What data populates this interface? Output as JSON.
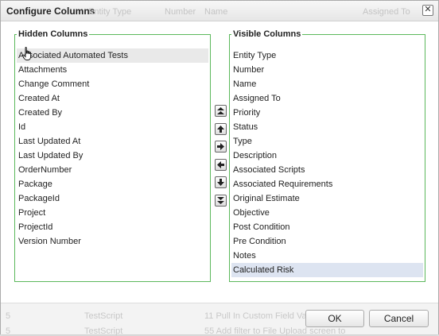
{
  "dialog": {
    "title": "Configure Columns",
    "close_label": "✕",
    "background_headers": [
      "Entity Type",
      "Number",
      "Name",
      "Assigned To"
    ]
  },
  "hidden_columns": {
    "legend": "Hidden Columns",
    "items": [
      "Associated Automated Tests",
      "Attachments",
      "Change Comment",
      "Created At",
      "Created By",
      "Id",
      "Last Updated At",
      "Last Updated By",
      "OrderNumber",
      "Package",
      "PackageId",
      "Project",
      "ProjectId",
      "Version Number"
    ]
  },
  "visible_columns": {
    "legend": "Visible Columns",
    "items": [
      "Entity Type",
      "Number",
      "Name",
      "Assigned To",
      "Priority",
      "Status",
      "Type",
      "Description",
      "Associated Scripts",
      "Associated Requirements",
      "Original Estimate",
      "Objective",
      "Post Condition",
      "Pre Condition",
      "Notes",
      "Calculated Risk"
    ],
    "selected": "Calculated Risk"
  },
  "move_buttons": [
    {
      "name": "move-top-button",
      "icon": "double-up-arrow-icon"
    },
    {
      "name": "move-up-button",
      "icon": "up-arrow-icon"
    },
    {
      "name": "move-right-button",
      "icon": "right-arrow-icon"
    },
    {
      "name": "move-left-button",
      "icon": "left-arrow-icon"
    },
    {
      "name": "move-down-button",
      "icon": "down-arrow-icon"
    },
    {
      "name": "move-bottom-button",
      "icon": "double-down-arrow-icon"
    }
  ],
  "footer": {
    "ok_label": "OK",
    "cancel_label": "Cancel",
    "background_rows": [
      {
        "id": "5",
        "type": "TestScript",
        "name": "11 Pull In Custom Field Va"
      },
      {
        "id": "5",
        "type": "TestScript",
        "name": "55 Add filter to File Upload screen to"
      }
    ]
  },
  "colors": {
    "fieldset_border": "#5cb85c",
    "selected_row": "#dde4f1",
    "hover_row": "#e9e9e9"
  }
}
